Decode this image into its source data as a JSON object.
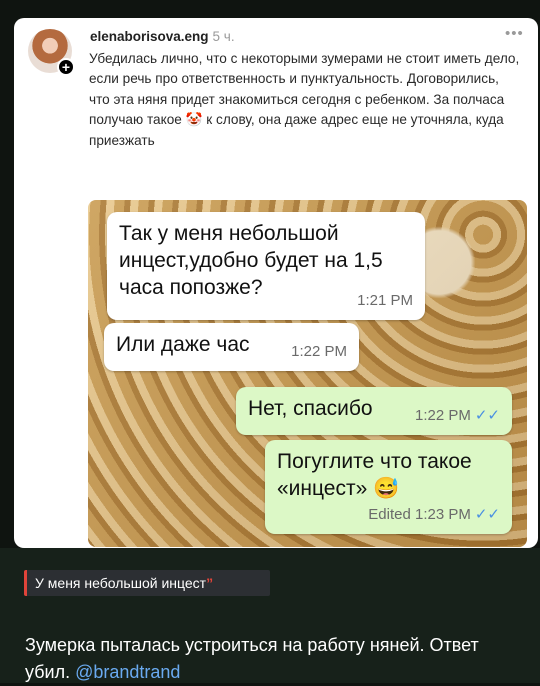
{
  "post": {
    "username": "elenaborisova.eng",
    "time": "5 ч.",
    "more_label": "•••",
    "plus_label": "+",
    "text": "Убедилась лично, что с некоторыми зумерами не стоит иметь дело, если речь про ответственность и пунктуальность. Договорились, что эта няня придет знакомиться сегодня с ребенком. За полчаса получаю такое 🤡 к слову, она даже адрес еще не уточняла, куда приезжать"
  },
  "chat": {
    "messages": [
      {
        "direction": "incoming",
        "text": "Так у меня небольшой инцест,удобно будет на 1,5 часа попозже?",
        "time": "1:21 PM"
      },
      {
        "direction": "incoming",
        "text": "Или даже час",
        "time": "1:22 PM"
      },
      {
        "direction": "outgoing",
        "text": "Нет, спасибо",
        "time": "1:22 PM",
        "ticks": "✓✓"
      },
      {
        "direction": "outgoing",
        "text": "Погуглите что такое «инцест» 😅",
        "edited": "Edited",
        "time": "1:23 PM",
        "ticks": "✓✓"
      }
    ]
  },
  "caption": {
    "quote": "У меня небольшой инцест",
    "quote_mark": "”",
    "text": "Зумерка пыталась устроиться на работу няней. Ответ убил.",
    "mention": "@brandtrand"
  },
  "colors": {
    "quote_accent": "#e0443a",
    "mention": "#6aaaf0",
    "outgoing_bubble": "#dcf8c6",
    "read_ticks": "#4a90e2"
  }
}
